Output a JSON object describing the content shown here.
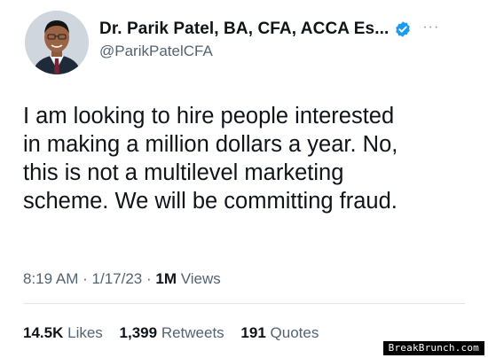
{
  "author": {
    "display_name": "Dr. Parik Patel, BA, CFA, ACCA Es...",
    "handle": "@ParikPatelCFA",
    "verified": true,
    "more_glyph": "···"
  },
  "tweet": {
    "text": "I am looking to hire people interested\nin making a million dollars a year. No,\nthis is not a multilevel marketing\nscheme. We will be committing fraud."
  },
  "meta": {
    "time": "8:19 AM",
    "separator": "·",
    "date": "1/17/23",
    "views_count": "1M",
    "views_label": "Views"
  },
  "stats": {
    "likes_count": "14.5K",
    "likes_label": "Likes",
    "retweets_count": "1,399",
    "retweets_label": "Retweets",
    "quotes_count": "191",
    "quotes_label": "Quotes"
  },
  "watermark": {
    "text": "BreakBrunch.com"
  },
  "colors": {
    "verified_badge": "#1d9bf0",
    "secondary_text": "#536471",
    "primary_text": "#0f1419"
  }
}
